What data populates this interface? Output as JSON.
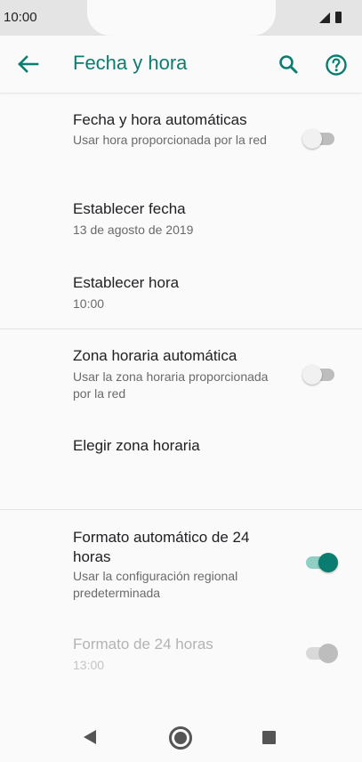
{
  "status_bar": {
    "time": "10:00"
  },
  "app_bar": {
    "title": "Fecha y hora"
  },
  "settings": {
    "auto_datetime": {
      "title": "Fecha y hora automáticas",
      "subtitle": "Usar hora proporcionada por la red",
      "enabled": false
    },
    "set_date": {
      "title": "Establecer fecha",
      "subtitle": "13 de agosto de 2019"
    },
    "set_time": {
      "title": "Establecer hora",
      "subtitle": "10:00"
    },
    "auto_timezone": {
      "title": "Zona horaria automática",
      "subtitle": "Usar la zona horaria proporcionada por la red",
      "enabled": false
    },
    "choose_timezone": {
      "title": "Elegir zona horaria"
    },
    "auto_24h": {
      "title": "Formato automático de 24 horas",
      "subtitle": "Usar la configuración regional predeterminada",
      "enabled": true
    },
    "format_24h": {
      "title": "Formato de 24 horas",
      "subtitle": "13:00",
      "enabled": true,
      "disabled": true
    }
  },
  "colors": {
    "accent": "#0b7d70",
    "switch_off_track": "#bdbdbd",
    "switch_on_track": "#8fcfc4"
  },
  "icons": {
    "back": "arrow-left-icon",
    "search": "search-icon",
    "help": "help-circle-icon",
    "nav_back": "triangle-back-icon",
    "nav_home": "circle-home-icon",
    "nav_recents": "square-recents-icon"
  }
}
